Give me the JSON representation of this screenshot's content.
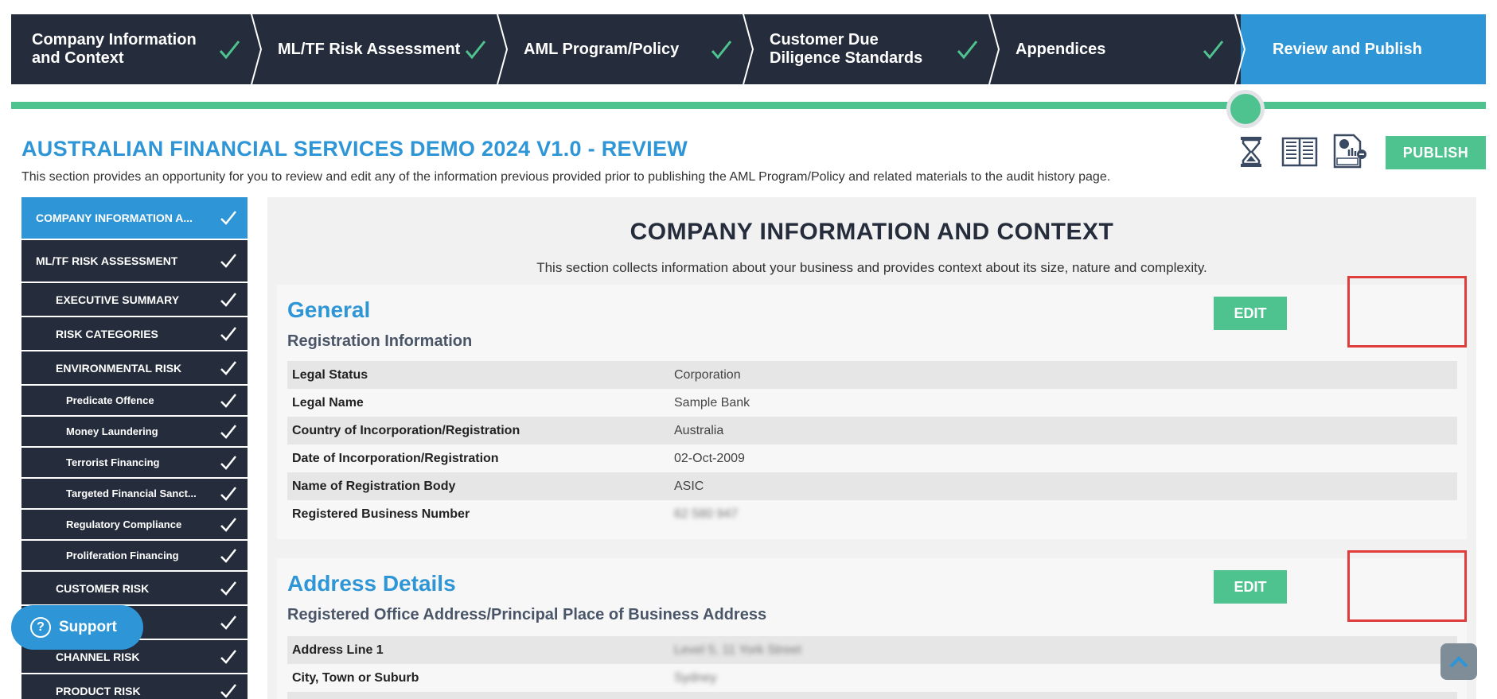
{
  "stepper": {
    "steps": [
      {
        "label": "Company Information\nand Context",
        "complete": true
      },
      {
        "label": "ML/TF Risk Assessment",
        "complete": true
      },
      {
        "label": "AML Program/Policy",
        "complete": true
      },
      {
        "label": "Customer Due\nDiligence Standards",
        "complete": true
      },
      {
        "label": "Appendices",
        "complete": true
      },
      {
        "label": "Review and Publish",
        "active": true
      }
    ]
  },
  "progress": {
    "fraction": 0.83
  },
  "header": {
    "title": "AUSTRALIAN FINANCIAL SERVICES DEMO 2024 V1.0 - REVIEW",
    "description": "This section provides an opportunity for you to review and edit any of the information previous provided prior to publishing the AML Program/Policy and related materials to the audit history page.",
    "icons": [
      "hourglass-icon",
      "book-icon",
      "draft-document-icon"
    ],
    "publish_label": "PUBLISH"
  },
  "sidebar": {
    "items": [
      {
        "label": "COMPANY INFORMATION A...",
        "level": 0,
        "active": true
      },
      {
        "label": "ML/TF RISK ASSESSMENT",
        "level": 0
      },
      {
        "label": "EXECUTIVE SUMMARY",
        "level": 1
      },
      {
        "label": "RISK CATEGORIES",
        "level": 1
      },
      {
        "label": "ENVIRONMENTAL RISK",
        "level": 1
      },
      {
        "label": "Predicate Offence",
        "level": 2
      },
      {
        "label": "Money Laundering",
        "level": 2
      },
      {
        "label": "Terrorist Financing",
        "level": 2
      },
      {
        "label": "Targeted Financial Sanct...",
        "level": 2
      },
      {
        "label": "Regulatory Compliance",
        "level": 2
      },
      {
        "label": "Proliferation Financing",
        "level": 2
      },
      {
        "label": "CUSTOMER RISK",
        "level": 1
      },
      {
        "label": "",
        "level": 1
      },
      {
        "label": "CHANNEL RISK",
        "level": 1
      },
      {
        "label": "PRODUCT RISK",
        "level": 1
      }
    ]
  },
  "main": {
    "heading": "COMPANY INFORMATION AND CONTEXT",
    "description": "This section collects information about your business and provides context about its size, nature and complexity.",
    "sections": [
      {
        "title": "General",
        "subtitle": "Registration Information",
        "edit_label": "EDIT",
        "rows": [
          {
            "key": "Legal Status",
            "value": "Corporation"
          },
          {
            "key": "Legal Name",
            "value": "Sample Bank"
          },
          {
            "key": "Country of Incorporation/Registration",
            "value": "Australia"
          },
          {
            "key": "Date of Incorporation/Registration",
            "value": "02-Oct-2009"
          },
          {
            "key": "Name of Registration Body",
            "value": "ASIC"
          },
          {
            "key": "Registered Business Number",
            "value": "62 580 947",
            "blurred": true
          }
        ]
      },
      {
        "title": "Address Details",
        "subtitle": "Registered Office Address/Principal Place of Business Address",
        "edit_label": "EDIT",
        "rows": [
          {
            "key": "Address Line 1",
            "value": "Level 5, 11 York Street",
            "blurred": true
          },
          {
            "key": "City, Town or Suburb",
            "value": "Sydney",
            "blurred": true
          }
        ]
      }
    ]
  },
  "support": {
    "label": "Support"
  },
  "colors": {
    "navy": "#252c3b",
    "blue": "#2e96d6",
    "green": "#4ec28f",
    "highlight": "#e03c3c"
  }
}
